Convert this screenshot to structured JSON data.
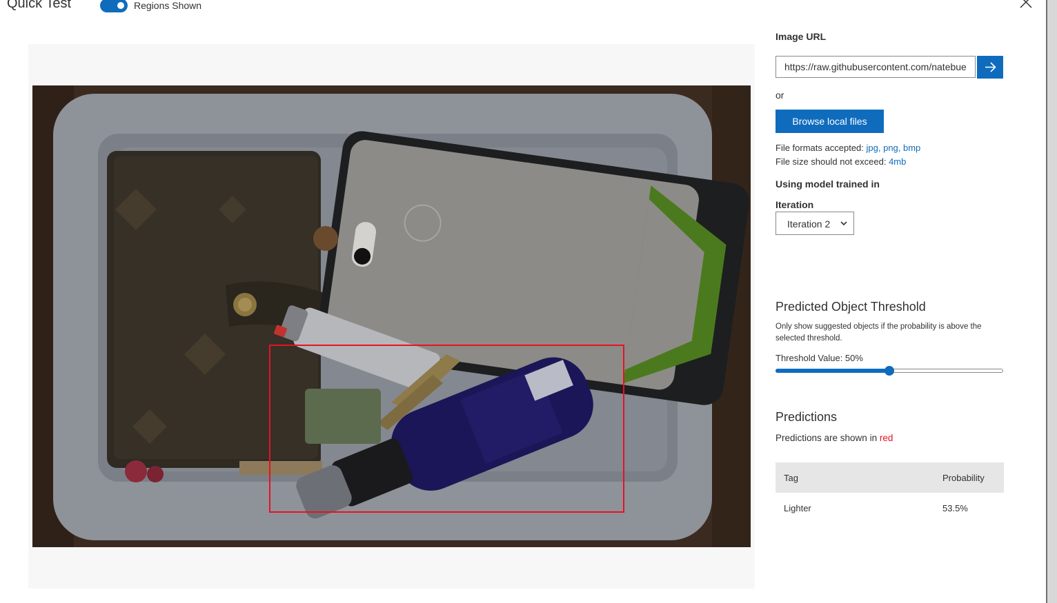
{
  "header": {
    "title": "Quick Test",
    "regions_toggle_label": "Regions Shown",
    "regions_toggle_on": true
  },
  "image_panel": {
    "prediction_box_color": "#e81123"
  },
  "sidebar": {
    "image_url_label": "Image URL",
    "image_url_value": "https://raw.githubusercontent.com/natebue",
    "or_text": "or",
    "browse_button": "Browse local files",
    "formats_label": "File formats accepted:",
    "formats_value": "jpg, png, bmp",
    "size_label": "File size should not exceed:",
    "size_value": "4mb",
    "model_label": "Using model trained in",
    "iteration_label": "Iteration",
    "iteration_selected": "Iteration 2"
  },
  "threshold": {
    "heading": "Predicted Object Threshold",
    "description": "Only show suggested objects if the probability is above the selected threshold.",
    "value_label": "Threshold Value: 50%",
    "value": 0.5
  },
  "predictions": {
    "heading": "Predictions",
    "note_prefix": "Predictions are shown in",
    "note_color_word": "red",
    "columns": [
      "Tag",
      "Probability"
    ],
    "rows": [
      {
        "tag": "Lighter",
        "probability": "53.5%"
      }
    ]
  },
  "colors": {
    "accent": "#0f6cbd",
    "prediction": "#e81123"
  }
}
